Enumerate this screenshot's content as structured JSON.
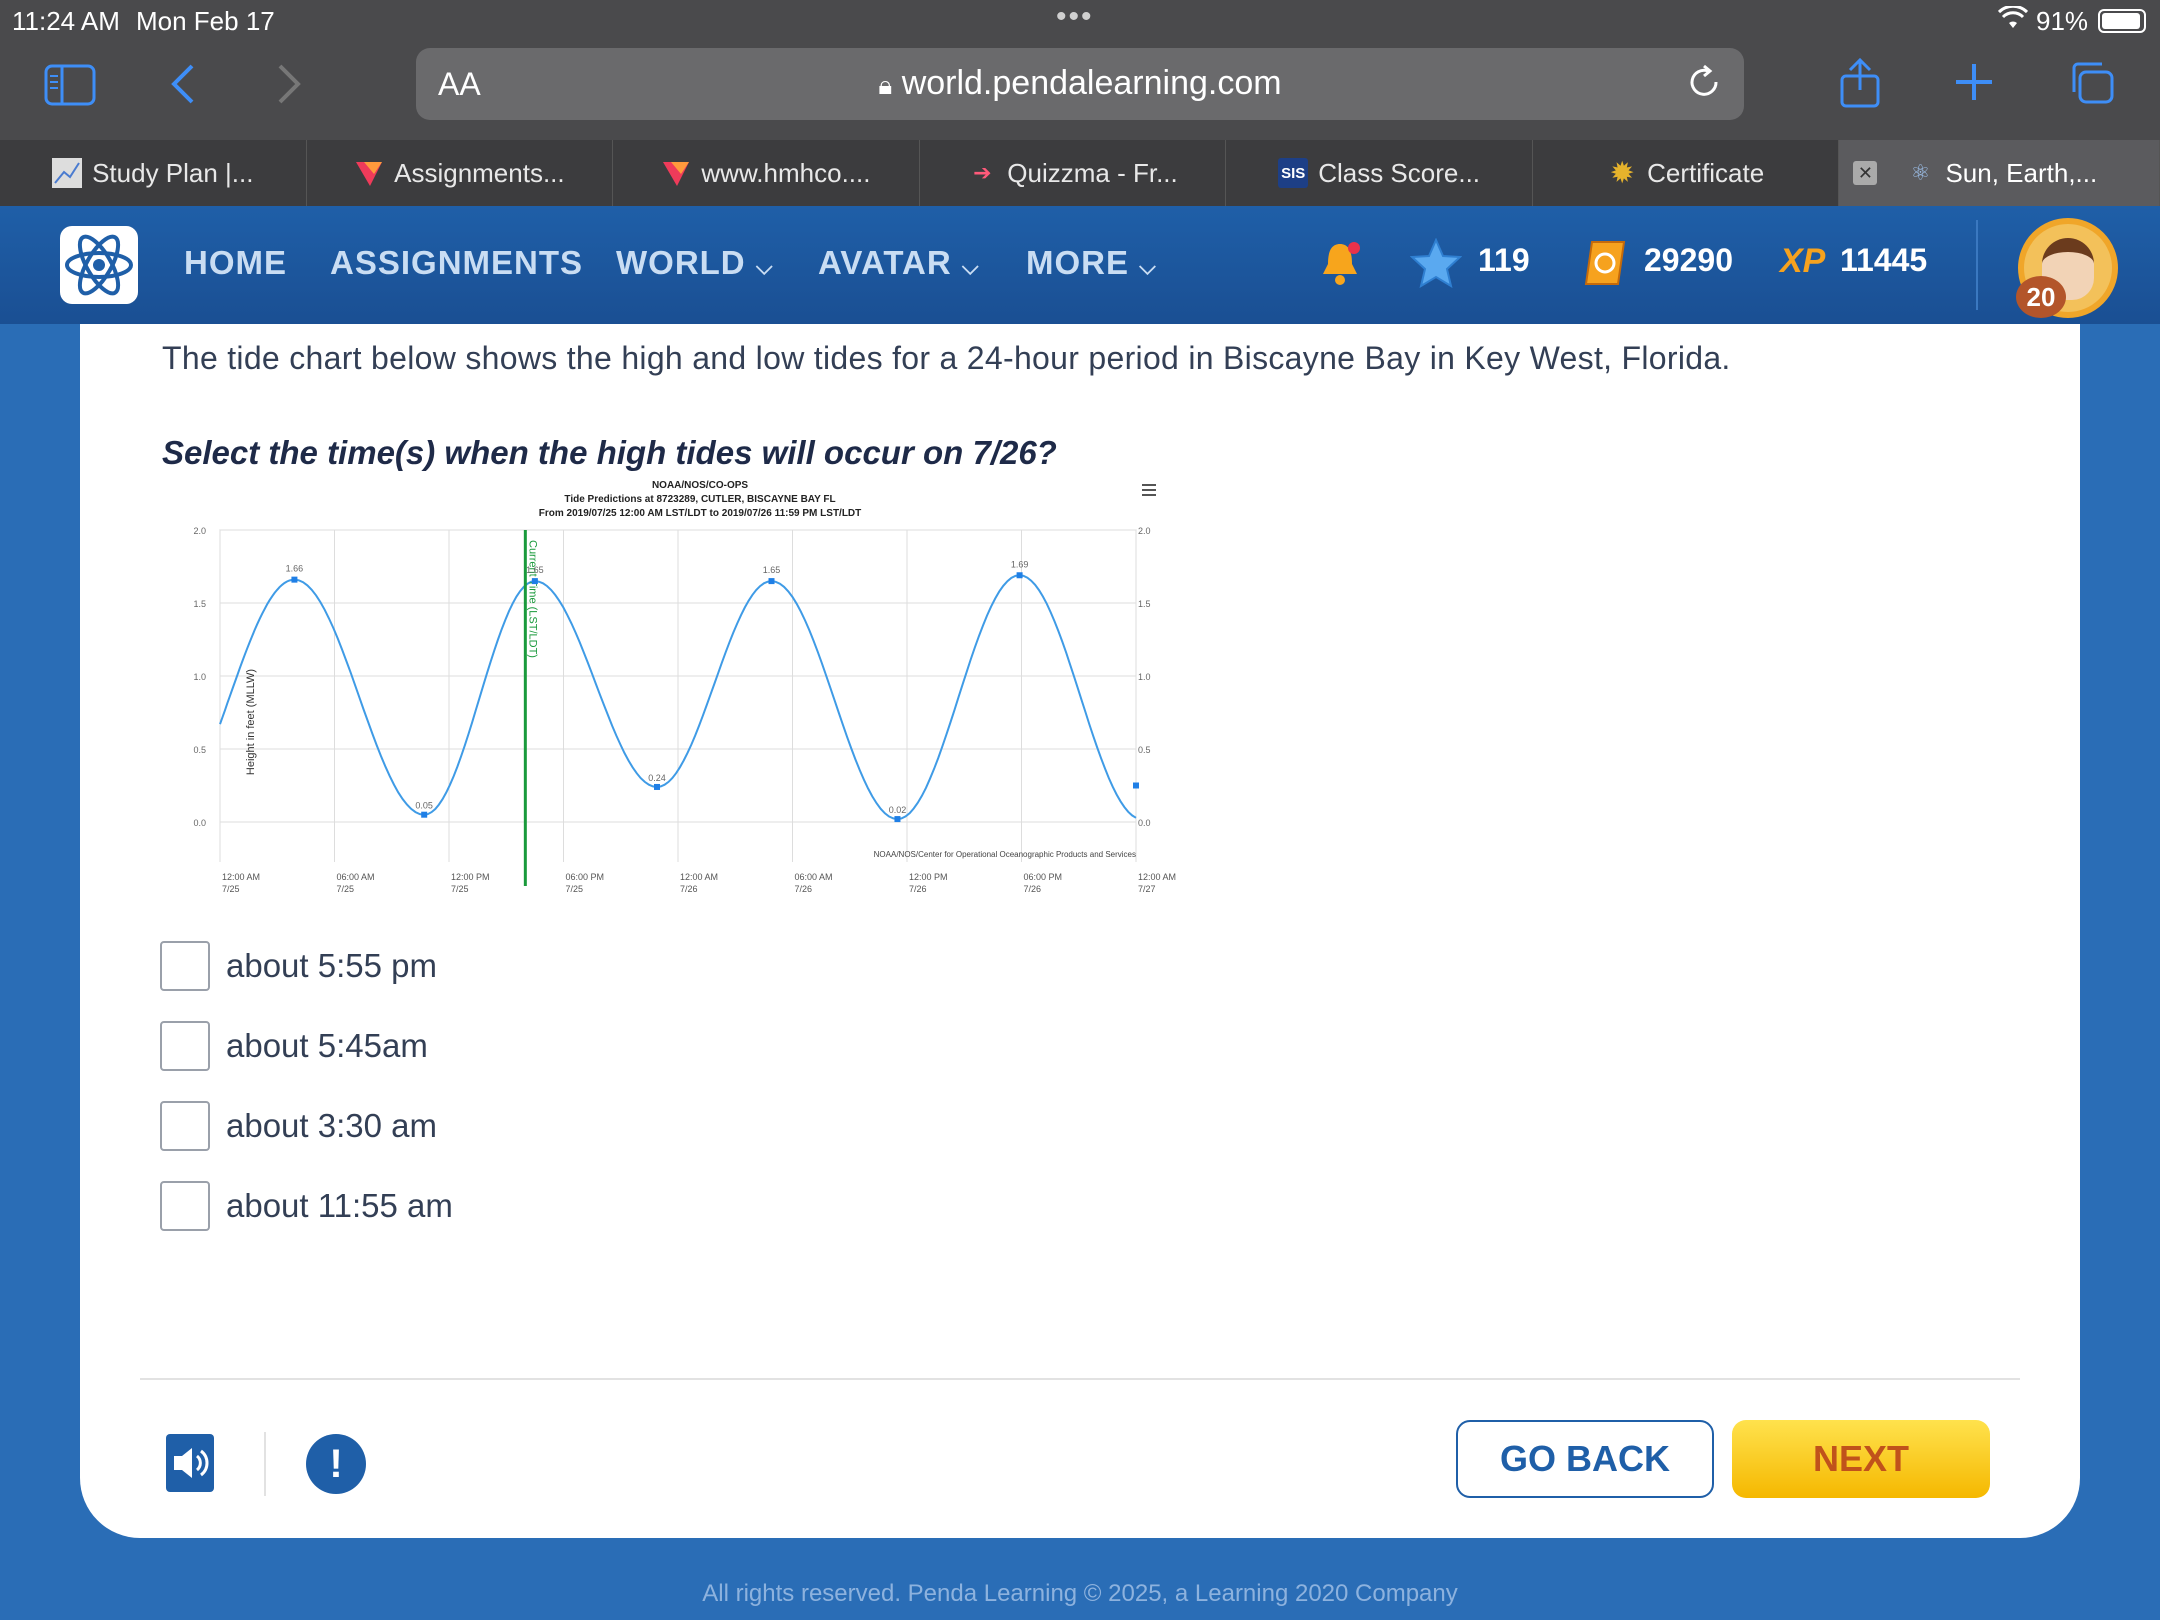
{
  "status": {
    "time": "11:24 AM",
    "date": "Mon Feb 17",
    "battery": "91%"
  },
  "browser": {
    "aa": "AA",
    "url": "world.pendalearning.com",
    "tabs": [
      {
        "label": "Study Plan |...",
        "icon": "chart-icon"
      },
      {
        "label": "Assignments...",
        "icon": "hmh-icon"
      },
      {
        "label": "www.hmhco....",
        "icon": "hmh-icon"
      },
      {
        "label": "Quizzma - Fr...",
        "icon": "arrow-icon"
      },
      {
        "label": "Class Score...",
        "icon": "sis-icon",
        "badge": "SIS"
      },
      {
        "label": "Certificate",
        "icon": "gear-icon"
      },
      {
        "label": "Sun, Earth,...",
        "icon": "atom-icon",
        "active": true
      }
    ]
  },
  "nav": {
    "home": "HOME",
    "assignments": "ASSIGNMENTS",
    "world": "WORLD",
    "avatar": "AVATAR",
    "more": "MORE",
    "stars": "119",
    "coins": "29290",
    "xp": "11445",
    "xp_label": "XP",
    "level": "20"
  },
  "content": {
    "prompt": "The tide chart below shows the high and low tides for a 24-hour period in Biscayne Bay in Key West, Florida.",
    "question": "Select the time(s) when the high tides will occur on 7/26?",
    "options": [
      "about 5:55 pm",
      "about 5:45am",
      "about 3:30 am",
      "about 11:55 am"
    ]
  },
  "buttons": {
    "back": "GO BACK",
    "next": "NEXT"
  },
  "footer": "All rights reserved. Penda Learning © 2025, a Learning 2020 Company",
  "colors": {
    "accent": "#1f5fa8",
    "curve": "#3f9be6",
    "now_line": "#1a9a3c",
    "next": "#f5b800"
  },
  "chart_data": {
    "type": "line",
    "title": "NOAA/NOS/CO-OPS",
    "subtitle": "Tide Predictions at 8723289, CUTLER, BISCAYNE BAY FL",
    "subtitle2": "From 2019/07/25 12:00 AM LST/LDT to 2019/07/26 11:59 PM LST/LDT",
    "ylabel": "Height in feet (MLLW)",
    "ylim": [
      0,
      2.0
    ],
    "yticks": [
      "0.0",
      "0.5",
      "1.0",
      "1.5",
      "2.0"
    ],
    "xlim_hours": [
      0,
      48
    ],
    "xticks": [
      {
        "t": "12:00 AM",
        "d": "7/25"
      },
      {
        "t": "06:00 AM",
        "d": "7/25"
      },
      {
        "t": "12:00 PM",
        "d": "7/25"
      },
      {
        "t": "06:00 PM",
        "d": "7/25"
      },
      {
        "t": "12:00 AM",
        "d": "7/26"
      },
      {
        "t": "06:00 AM",
        "d": "7/26"
      },
      {
        "t": "12:00 PM",
        "d": "7/26"
      },
      {
        "t": "06:00 PM",
        "d": "7/26"
      },
      {
        "t": "12:00 AM",
        "d": "7/27"
      }
    ],
    "extrema": [
      {
        "h": 3.9,
        "v": 1.66,
        "label": "1.66"
      },
      {
        "h": 10.7,
        "v": 0.05,
        "label": "0.05"
      },
      {
        "h": 16.5,
        "v": 1.65,
        "label": "1.65"
      },
      {
        "h": 22.9,
        "v": 0.24,
        "label": "0.24"
      },
      {
        "h": 28.9,
        "v": 1.65,
        "label": "1.65"
      },
      {
        "h": 35.5,
        "v": 0.02,
        "label": "0.02"
      },
      {
        "h": 41.9,
        "v": 1.69,
        "label": "1.69"
      }
    ],
    "start": {
      "h": 0,
      "v": 0.5
    },
    "end": {
      "h": 48,
      "v": 0.25
    },
    "current_time_hours": 16.0,
    "current_time_label": "Current Time (LST/LDT)",
    "credit": "NOAA/NOS/Center for Operational Oceanographic Products and Services"
  }
}
